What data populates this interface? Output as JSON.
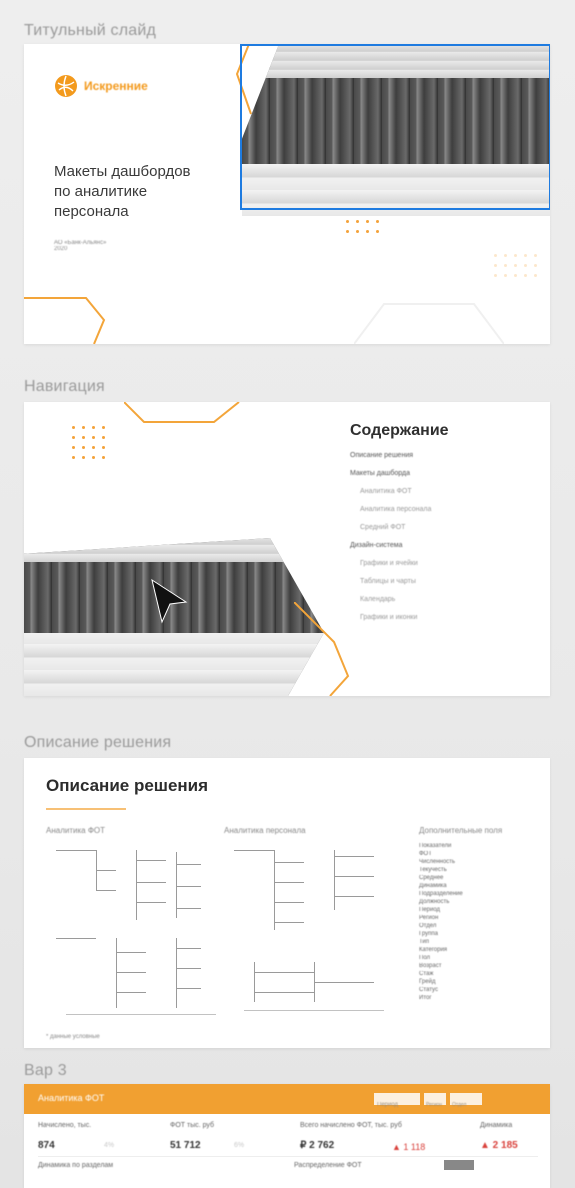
{
  "sections": [
    {
      "label": "Титульный слайд"
    },
    {
      "label": "Навигация"
    },
    {
      "label": "Описание решения"
    },
    {
      "label": "Вар 3"
    }
  ],
  "title_slide": {
    "logo_text": "Искренние",
    "headline": "Макеты дашбордов по аналитике персонала",
    "headline_lines": [
      "Макеты дашбордов",
      "по аналитике",
      "персонала"
    ],
    "meta_lines": [
      "АО «Банк-Альянс»",
      "2020"
    ]
  },
  "navigation_slide": {
    "heading": "Содержание",
    "items": [
      "Описание решения",
      "Макеты дашборда",
      "Аналитика ФОТ",
      "Аналитика персонала",
      "Средний ФОТ",
      "Дизайн-система",
      "Графики и ячейки",
      "Таблицы и чарты",
      "Календарь",
      "Графики и иконки"
    ]
  },
  "description_slide": {
    "heading": "Описание решения",
    "columns": [
      "Аналитика ФОТ",
      "Аналитика персонала",
      "Дополнительные поля"
    ],
    "right_list": [
      "Показатели",
      "ФОТ",
      "Численность",
      "Текучесть",
      "Среднее",
      "Динамика",
      "Подразделение",
      "Должность",
      "Период",
      "Регион",
      "Отдел",
      "Группа",
      "Тип",
      "Категория",
      "Пол",
      "Возраст",
      "Стаж",
      "Грейд",
      "Статус",
      "Итог"
    ],
    "footer_note": "* данные условные"
  },
  "dashboard_slide": {
    "title": "Аналитика ФОТ",
    "filters": [
      "Период",
      "Регион",
      "Отдел"
    ],
    "kpis": [
      {
        "label": "Начислено, тыс.",
        "value": "874",
        "delta": "4%"
      },
      {
        "label": "ФОТ тыс. руб",
        "value": "51 712",
        "delta": "6%"
      },
      {
        "label": "Всего начислено ФОТ, тыс. руб",
        "value": "₽ 2 762",
        "delta": "▲ 1 118"
      },
      {
        "label": "Динамика",
        "value": "▲ 2 185",
        "delta": ""
      }
    ],
    "subheads": [
      "Динамика по разделам",
      "Распределение ФОТ"
    ]
  },
  "colors": {
    "accent": "#f39a1d",
    "highlight": "#1e7be0",
    "background": "#ececec"
  },
  "icons": [
    "logo-icon",
    "cursor-arrow-icon"
  ]
}
